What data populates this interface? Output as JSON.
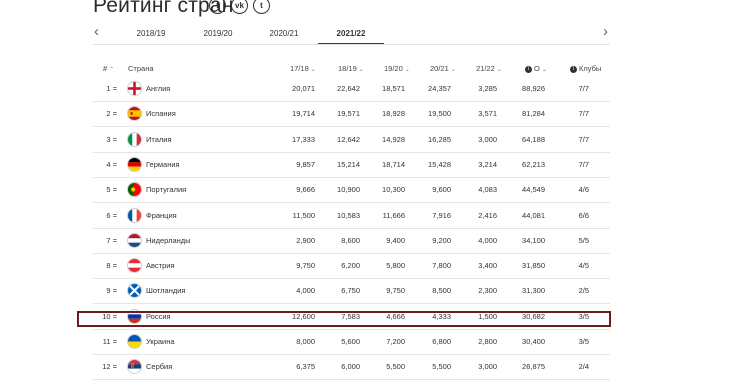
{
  "page": {
    "title": "Рейтинг стран"
  },
  "social": [
    {
      "name": "facebook-icon",
      "glyph": "f"
    },
    {
      "name": "vk-icon",
      "glyph": "vk"
    },
    {
      "name": "twitter-icon",
      "glyph": "t"
    }
  ],
  "nav": {
    "prev": "‹",
    "next": "›"
  },
  "tabs": [
    {
      "label": "2018/19",
      "active": false
    },
    {
      "label": "2019/20",
      "active": false
    },
    {
      "label": "2020/21",
      "active": false
    },
    {
      "label": "2021/22",
      "active": true
    }
  ],
  "table": {
    "headers": {
      "rank": "#",
      "country": "Страна",
      "s1718": "17/18",
      "s1819": "18/19",
      "s1920": "19/20",
      "s2021": "20/21",
      "s2122": "21/22",
      "points": "О",
      "clubs": "Клубы"
    },
    "rows": [
      {
        "rank": "1 =",
        "country": "Англия",
        "flag": "england",
        "v": [
          "20,071",
          "22,642",
          "18,571",
          "24,357",
          "3,285"
        ],
        "points": "88,926",
        "clubs": "7/7"
      },
      {
        "rank": "2 =",
        "country": "Испания",
        "flag": "spain",
        "v": [
          "19,714",
          "19,571",
          "18,928",
          "19,500",
          "3,571"
        ],
        "points": "81,284",
        "clubs": "7/7"
      },
      {
        "rank": "3 =",
        "country": "Италия",
        "flag": "italy",
        "v": [
          "17,333",
          "12,642",
          "14,928",
          "16,285",
          "3,000"
        ],
        "points": "64,188",
        "clubs": "7/7"
      },
      {
        "rank": "4 =",
        "country": "Германия",
        "flag": "germany",
        "v": [
          "9,857",
          "15,214",
          "18,714",
          "15,428",
          "3,214"
        ],
        "points": "62,213",
        "clubs": "7/7"
      },
      {
        "rank": "5 =",
        "country": "Португалия",
        "flag": "portugal",
        "v": [
          "9,666",
          "10,900",
          "10,300",
          "9,600",
          "4,083"
        ],
        "points": "44,549",
        "clubs": "4/6"
      },
      {
        "rank": "6 =",
        "country": "Франция",
        "flag": "france",
        "v": [
          "11,500",
          "10,583",
          "11,666",
          "7,916",
          "2,416"
        ],
        "points": "44,081",
        "clubs": "6/6"
      },
      {
        "rank": "7 =",
        "country": "Нидерланды",
        "flag": "netherlands",
        "v": [
          "2,900",
          "8,600",
          "9,400",
          "9,200",
          "4,000"
        ],
        "points": "34,100",
        "clubs": "5/5"
      },
      {
        "rank": "8 =",
        "country": "Австрия",
        "flag": "austria",
        "v": [
          "9,750",
          "6,200",
          "5,800",
          "7,800",
          "3,400"
        ],
        "points": "31,850",
        "clubs": "4/5"
      },
      {
        "rank": "9 =",
        "country": "Шотландия",
        "flag": "scotland",
        "v": [
          "4,000",
          "6,750",
          "9,750",
          "8,500",
          "2,300"
        ],
        "points": "31,300",
        "clubs": "2/5"
      },
      {
        "rank": "10 =",
        "country": "Россия",
        "flag": "russia",
        "v": [
          "12,600",
          "7,583",
          "4,666",
          "4,333",
          "1,500"
        ],
        "points": "30,682",
        "clubs": "3/5"
      },
      {
        "rank": "11 =",
        "country": "Украина",
        "flag": "ukraine",
        "v": [
          "8,000",
          "5,600",
          "7,200",
          "6,800",
          "2,800"
        ],
        "points": "30,400",
        "clubs": "3/5"
      },
      {
        "rank": "12 =",
        "country": "Сербия",
        "flag": "serbia",
        "v": [
          "6,375",
          "6,000",
          "5,500",
          "5,500",
          "3,000"
        ],
        "points": "26,875",
        "clubs": "2/4"
      }
    ]
  }
}
